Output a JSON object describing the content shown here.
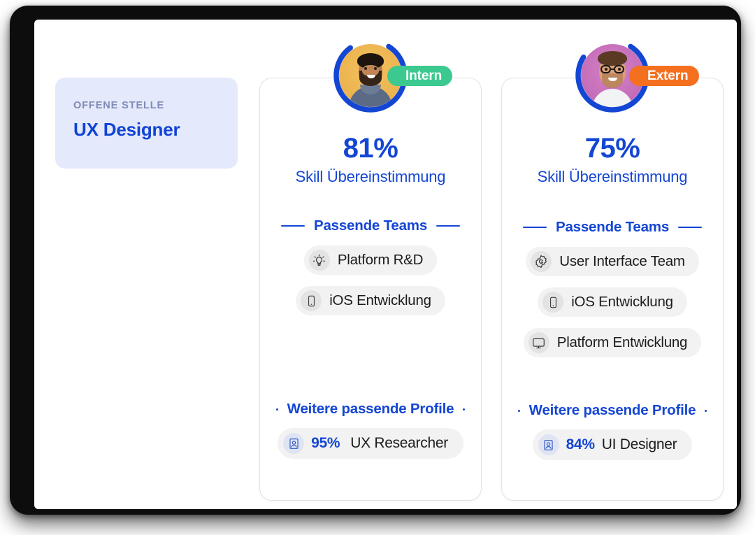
{
  "job": {
    "eyebrow": "OFFENE STELLE",
    "title": "UX Designer",
    "bg_color": "#e4e9fb",
    "title_color": "#1043d6"
  },
  "theme": {
    "brand_blue": "#1446d4",
    "internal_green": "#3cc98f",
    "external_orange": "#f4701f",
    "pill_grey": "#f2f2f3",
    "card_border": "#e2e2e4"
  },
  "candidates": [
    {
      "badge": {
        "label": "Intern",
        "color": "#3cc98f",
        "name": "internal"
      },
      "avatar": {
        "name": "candidate-photo-internal",
        "bg_color": "#e8ae49"
      },
      "match_percent": "81%",
      "match_value": 81,
      "match_label": "Skill Übereinstimmung",
      "teams_heading": "Passende Teams",
      "teams": [
        {
          "label": "Platform R&D",
          "icon": "lightbulb-icon"
        },
        {
          "label": "iOS Entwicklung",
          "icon": "phone-icon"
        }
      ],
      "profiles_heading": "Weitere passende Profile",
      "profiles": [
        {
          "score": "95%",
          "role": "UX Researcher",
          "icon": "profile-card-icon"
        }
      ]
    },
    {
      "badge": {
        "label": "Extern",
        "color": "#f4701f",
        "name": "external"
      },
      "avatar": {
        "name": "candidate-photo-external",
        "bg_color": "#bf62b2"
      },
      "match_percent": "75%",
      "match_value": 75,
      "match_label": "Skill Übereinstimmung",
      "teams_heading": "Passende Teams",
      "teams": [
        {
          "label": "User Interface Team",
          "icon": "rosette-badge-icon"
        },
        {
          "label": "iOS Entwicklung",
          "icon": "phone-icon"
        },
        {
          "label": "Platform Entwicklung",
          "icon": "monitor-icon"
        }
      ],
      "profiles_heading": "Weitere passende Profile",
      "profiles": [
        {
          "score": "84%",
          "role": "UI Designer",
          "icon": "profile-card-icon"
        }
      ]
    }
  ]
}
